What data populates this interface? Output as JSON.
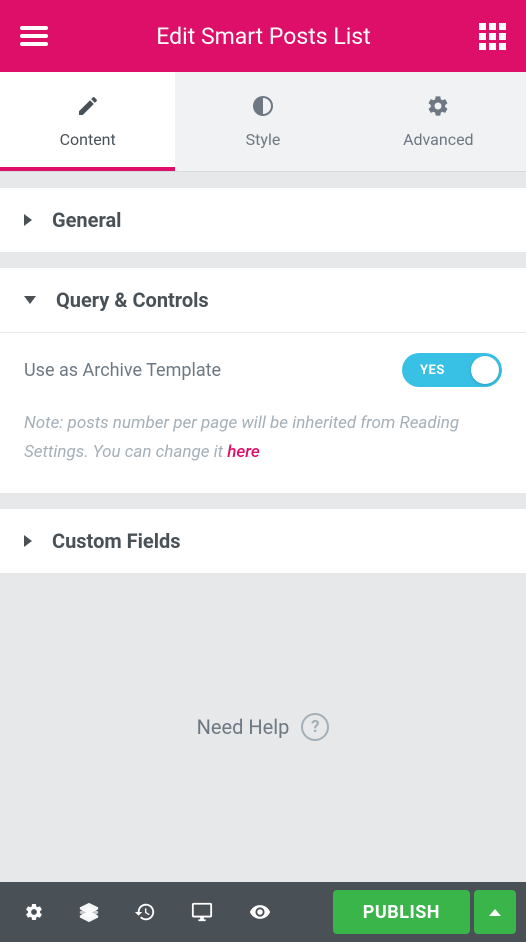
{
  "header": {
    "title": "Edit Smart Posts List"
  },
  "tabs": {
    "content": "Content",
    "style": "Style",
    "advanced": "Advanced"
  },
  "sections": {
    "general": "General",
    "query": "Query & Controls",
    "custom_fields": "Custom Fields"
  },
  "controls": {
    "archive_label": "Use as Archive Template",
    "toggle_state": "YES",
    "note_prefix": "Note: posts number per page will be inherited from Reading Settings. You can change it ",
    "note_link": "here"
  },
  "help": {
    "text": "Need Help"
  },
  "footer": {
    "publish": "PUBLISH"
  }
}
